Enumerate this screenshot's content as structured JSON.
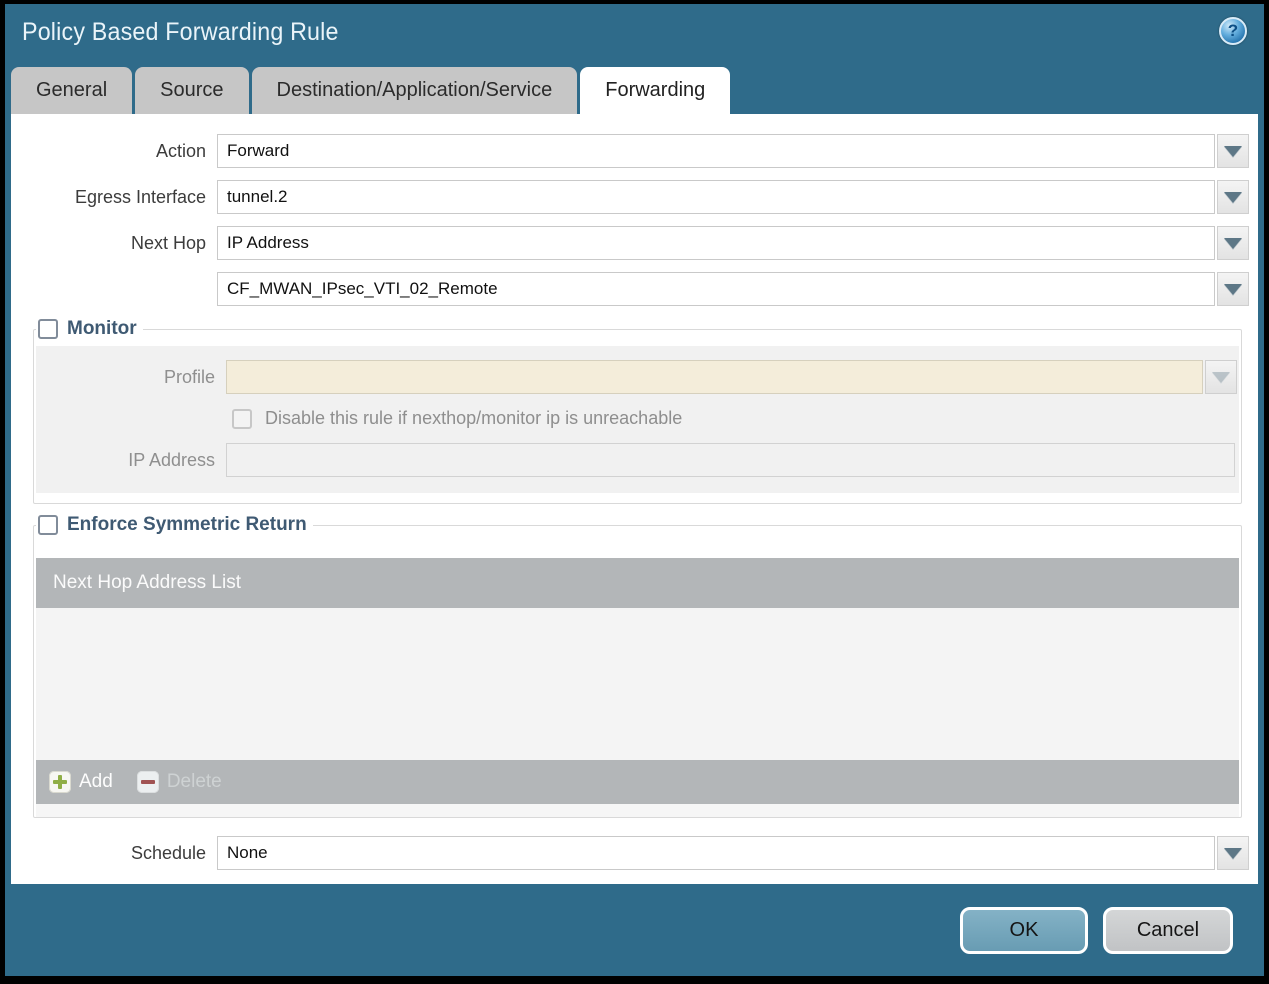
{
  "window": {
    "title": "Policy Based Forwarding Rule",
    "help_glyph": "?"
  },
  "tabs": [
    {
      "label": "General",
      "active": false
    },
    {
      "label": "Source",
      "active": false
    },
    {
      "label": "Destination/Application/Service",
      "active": false
    },
    {
      "label": "Forwarding",
      "active": true
    }
  ],
  "form": {
    "action": {
      "label": "Action",
      "value": "Forward"
    },
    "egress_interface": {
      "label": "Egress Interface",
      "value": "tunnel.2"
    },
    "next_hop": {
      "label": "Next Hop",
      "value": "IP Address"
    },
    "next_hop_address": {
      "value": "CF_MWAN_IPsec_VTI_02_Remote"
    },
    "schedule": {
      "label": "Schedule",
      "value": "None"
    }
  },
  "monitor": {
    "legend": "Monitor",
    "checked": false,
    "profile": {
      "label": "Profile",
      "value": ""
    },
    "disable_rule": {
      "label": "Disable this rule if nexthop/monitor ip is unreachable",
      "checked": false
    },
    "ip_address": {
      "label": "IP Address",
      "value": ""
    }
  },
  "symmetric_return": {
    "legend": "Enforce Symmetric Return",
    "checked": false,
    "table": {
      "header": "Next Hop Address List",
      "rows": []
    },
    "add_label": "Add",
    "delete_label": "Delete",
    "delete_enabled": false
  },
  "footer": {
    "ok_label": "OK",
    "cancel_label": "Cancel"
  },
  "icons": {
    "help": "question-mark-circle",
    "dropdown": "triangle-down",
    "add": "plus-square",
    "delete": "minus-square"
  },
  "colors": {
    "titlebar_teal": "#2f6b8a",
    "tab_gray": "#c6c6c6",
    "active_tab": "#ffffff",
    "ok_button": "#74a6bc",
    "cancel_button": "#c9cbcd",
    "disabled_field_beige": "#f4edda",
    "table_header_gray": "#b3b6b8",
    "add_icon_green": "#8fae45",
    "delete_icon_red": "#a05252",
    "legend_text": "#3f5a73"
  }
}
